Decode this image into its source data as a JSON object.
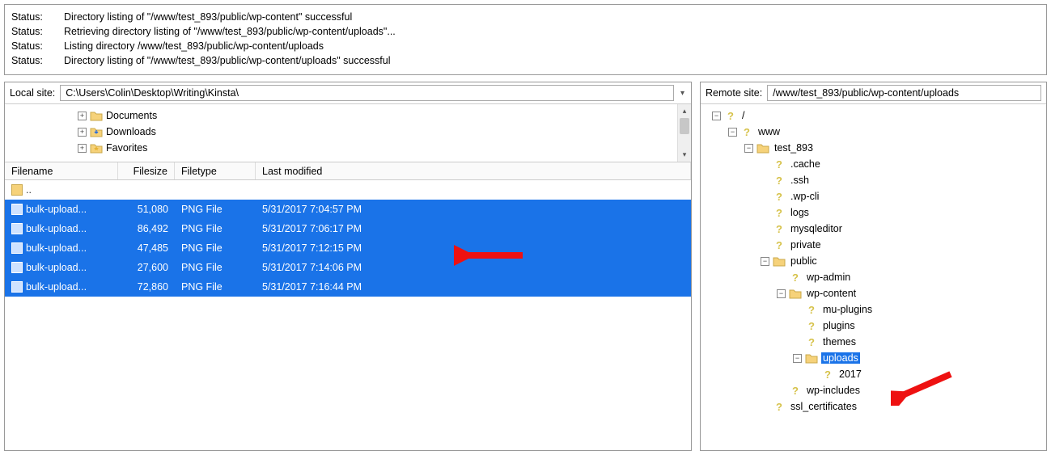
{
  "status": {
    "label": "Status:",
    "rows": [
      "Directory listing of \"/www/test_893/public/wp-content\" successful",
      "Retrieving directory listing of \"/www/test_893/public/wp-content/uploads\"...",
      "Listing directory /www/test_893/public/wp-content/uploads",
      "Directory listing of \"/www/test_893/public/wp-content/uploads\" successful"
    ]
  },
  "local": {
    "label": "Local site:",
    "path": "C:\\Users\\Colin\\Desktop\\Writing\\Kinsta\\",
    "quicktree": [
      {
        "label": "Documents"
      },
      {
        "label": "Downloads"
      },
      {
        "label": "Favorites"
      }
    ],
    "columns": {
      "name": "Filename",
      "size": "Filesize",
      "type": "Filetype",
      "mod": "Last modified"
    },
    "parent_row": "..",
    "files": [
      {
        "name": "bulk-upload...",
        "size": "51,080",
        "type": "PNG File",
        "mod": "5/31/2017 7:04:57 PM"
      },
      {
        "name": "bulk-upload...",
        "size": "86,492",
        "type": "PNG File",
        "mod": "5/31/2017 7:06:17 PM"
      },
      {
        "name": "bulk-upload...",
        "size": "47,485",
        "type": "PNG File",
        "mod": "5/31/2017 7:12:15 PM"
      },
      {
        "name": "bulk-upload...",
        "size": "27,600",
        "type": "PNG File",
        "mod": "5/31/2017 7:14:06 PM"
      },
      {
        "name": "bulk-upload...",
        "size": "72,860",
        "type": "PNG File",
        "mod": "5/31/2017 7:16:44 PM"
      }
    ]
  },
  "remote": {
    "label": "Remote site:",
    "path": "/www/test_893/public/wp-content/uploads",
    "tree": [
      {
        "depth": 0,
        "exp": "minus",
        "icon": "q",
        "label": "/"
      },
      {
        "depth": 1,
        "exp": "minus",
        "icon": "q",
        "label": "www"
      },
      {
        "depth": 2,
        "exp": "minus",
        "icon": "folder",
        "label": "test_893"
      },
      {
        "depth": 3,
        "exp": "none",
        "icon": "q",
        "label": ".cache"
      },
      {
        "depth": 3,
        "exp": "none",
        "icon": "q",
        "label": ".ssh"
      },
      {
        "depth": 3,
        "exp": "none",
        "icon": "q",
        "label": ".wp-cli"
      },
      {
        "depth": 3,
        "exp": "none",
        "icon": "q",
        "label": "logs"
      },
      {
        "depth": 3,
        "exp": "none",
        "icon": "q",
        "label": "mysqleditor"
      },
      {
        "depth": 3,
        "exp": "none",
        "icon": "q",
        "label": "private"
      },
      {
        "depth": 3,
        "exp": "minus",
        "icon": "folder",
        "label": "public"
      },
      {
        "depth": 4,
        "exp": "none",
        "icon": "q",
        "label": "wp-admin"
      },
      {
        "depth": 4,
        "exp": "minus",
        "icon": "folder",
        "label": "wp-content"
      },
      {
        "depth": 5,
        "exp": "none",
        "icon": "q",
        "label": "mu-plugins"
      },
      {
        "depth": 5,
        "exp": "none",
        "icon": "q",
        "label": "plugins"
      },
      {
        "depth": 5,
        "exp": "none",
        "icon": "q",
        "label": "themes"
      },
      {
        "depth": 5,
        "exp": "minus",
        "icon": "folder",
        "label": "uploads",
        "selected": true
      },
      {
        "depth": 6,
        "exp": "none",
        "icon": "q",
        "label": "2017"
      },
      {
        "depth": 4,
        "exp": "none",
        "icon": "q",
        "label": "wp-includes"
      },
      {
        "depth": 3,
        "exp": "none",
        "icon": "q",
        "label": "ssl_certificates"
      }
    ]
  }
}
